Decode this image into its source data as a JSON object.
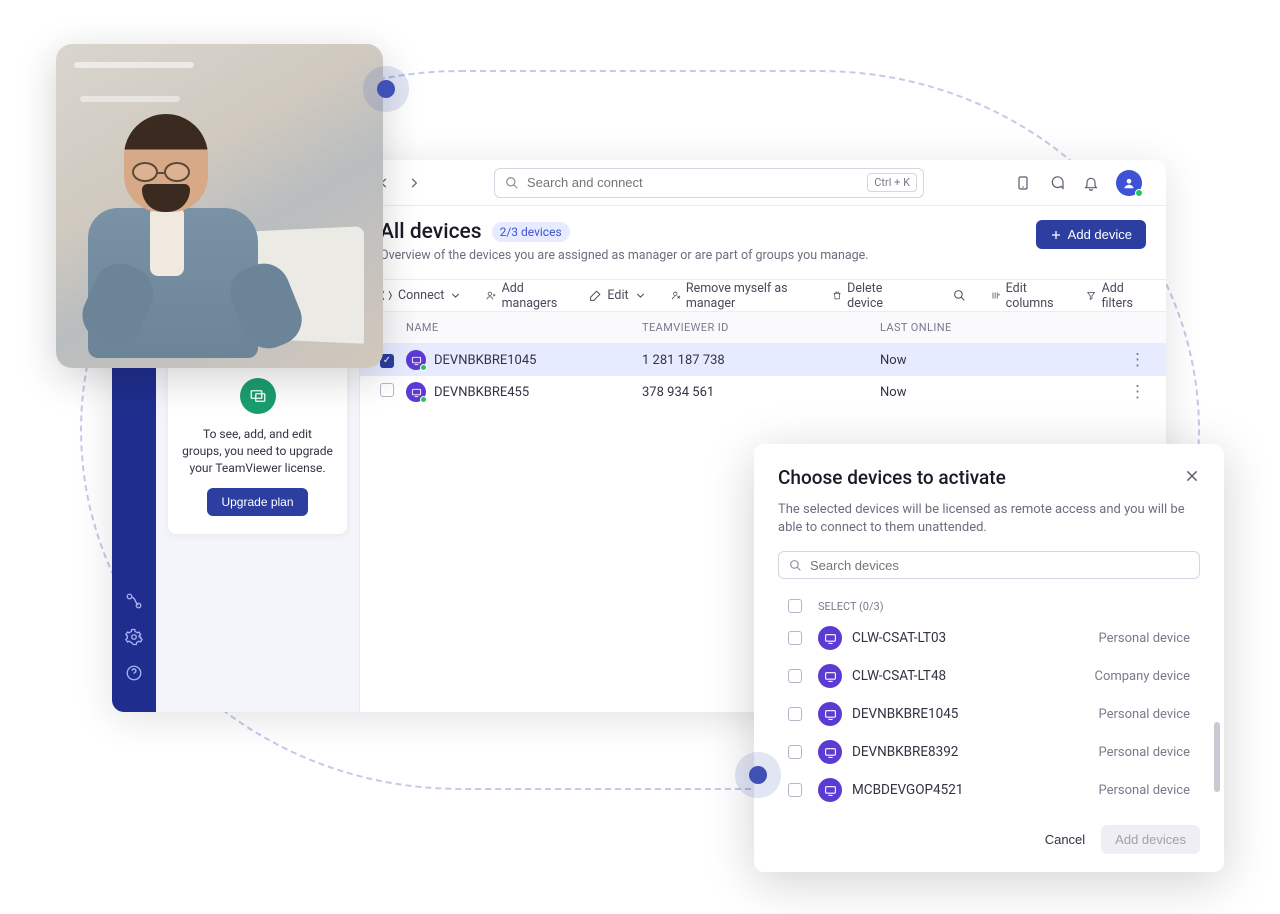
{
  "topbar": {
    "search_placeholder": "Search and connect",
    "shortcut": "Ctrl + K"
  },
  "upsell": {
    "text": "To see, add, and edit groups, you need to upgrade your TeamViewer license.",
    "button": "Upgrade plan"
  },
  "page": {
    "title": "All devices",
    "count_badge": "2/3 devices",
    "subtitle": "Overview of the devices you are assigned as manager or are part of groups you manage.",
    "add_device": "Add device"
  },
  "toolbar": {
    "connect": "Connect",
    "add_managers": "Add managers",
    "edit": "Edit",
    "remove_self": "Remove myself as manager",
    "delete": "Delete device",
    "edit_columns": "Edit columns",
    "add_filters": "Add filters"
  },
  "columns": {
    "name": "NAME",
    "tv_id": "TEAMVIEWER ID",
    "last_online": "LAST ONLINE"
  },
  "devices": [
    {
      "name": "DEVNBKBRE1045",
      "tv_id": "1 281 187 738",
      "last_online": "Now",
      "selected": true
    },
    {
      "name": "DEVNBKBRE455",
      "tv_id": "378 934 561",
      "last_online": "Now",
      "selected": false
    }
  ],
  "modal": {
    "title": "Choose devices to activate",
    "description": "The selected devices will be licensed as remote access and you will be able to connect to them unattended.",
    "search_placeholder": "Search devices",
    "select_label": "SELECT (0/3)",
    "cancel": "Cancel",
    "add": "Add devices",
    "options": [
      {
        "name": "CLW-CSAT-LT03",
        "type": "Personal device"
      },
      {
        "name": "CLW-CSAT-LT48",
        "type": "Company device"
      },
      {
        "name": "DEVNBKBRE1045",
        "type": "Personal device"
      },
      {
        "name": "DEVNBKBRE8392",
        "type": "Personal device"
      },
      {
        "name": "MCBDEVGOP4521",
        "type": "Personal device"
      }
    ]
  }
}
